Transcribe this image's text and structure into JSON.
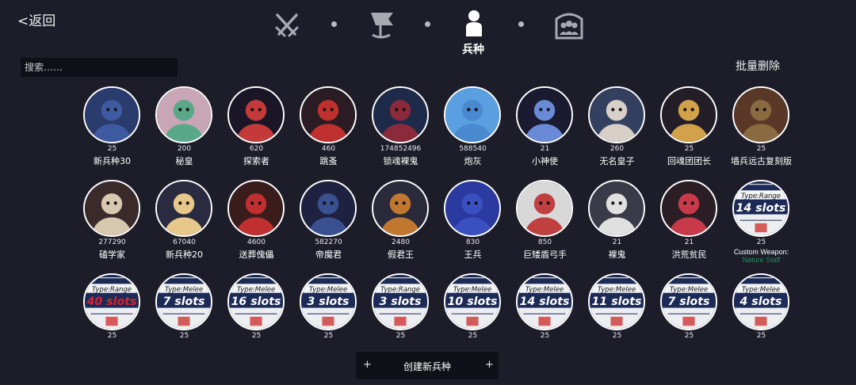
{
  "back": {
    "label": "<返回"
  },
  "nav": {
    "items": [
      {
        "icon": "crossed-swords-icon"
      },
      {
        "icon": "flag-icon"
      },
      {
        "icon": "unit-person-icon",
        "label": "兵种",
        "active": true
      },
      {
        "icon": "faction-group-icon"
      }
    ]
  },
  "search": {
    "placeholder": "搜索……",
    "value": ""
  },
  "batch_delete": {
    "label": "批量删除"
  },
  "units": [
    {
      "cost": "25",
      "name": "新兵种30",
      "icon": "hooded-blue-unit-icon"
    },
    {
      "cost": "200",
      "name": "秘皇",
      "icon": "masked-emperor-icon"
    },
    {
      "cost": "620",
      "name": "探索者",
      "icon": "explorer-teeth-icon"
    },
    {
      "cost": "460",
      "name": "跳蚤",
      "icon": "flea-red-unit-icon"
    },
    {
      "cost": "174852496",
      "name": "锁魂裸鬼",
      "icon": "soul-lock-ghost-icon"
    },
    {
      "cost": "588540",
      "name": "炮灰",
      "icon": "blue-blob-icon"
    },
    {
      "cost": "21",
      "name": "小神使",
      "icon": "little-envoy-icon"
    },
    {
      "cost": "260",
      "name": "无名皇子",
      "icon": "nameless-prince-icon"
    },
    {
      "cost": "25",
      "name": "回魂团团长",
      "icon": "soul-captain-icon"
    },
    {
      "cost": "25",
      "name": "墙兵远古复刻版",
      "icon": "wizard-hat-icon"
    },
    {
      "cost": "277290",
      "name": "磕学家",
      "icon": "antler-scholar-icon"
    },
    {
      "cost": "67040",
      "name": "新兵种20",
      "icon": "gold-robe-unit-icon"
    },
    {
      "cost": "4600",
      "name": "送葬傀儡",
      "icon": "funeral-puppet-icon"
    },
    {
      "cost": "582270",
      "name": "帝魔君",
      "icon": "demon-lord-icon"
    },
    {
      "cost": "2480",
      "name": "假君王",
      "icon": "false-king-icon"
    },
    {
      "cost": "830",
      "name": "王兵",
      "icon": "royal-soldier-icon"
    },
    {
      "cost": "850",
      "name": "巨矮盾弓手",
      "icon": "snowman-archer-icon"
    },
    {
      "cost": "21",
      "name": "裸鬼",
      "icon": "white-ghost-icon"
    },
    {
      "cost": "21",
      "name": "洪荒贫民",
      "icon": "primal-pauper-icon"
    },
    {
      "cost": "25",
      "name": "",
      "icon": "weapon-card-icon",
      "card_type": "Type:Range",
      "card_slots": "14 slots",
      "extra_line1": "Custom Weapon:",
      "extra_line2": "Nature Staff"
    },
    {
      "cost": "25",
      "card_type": "Type:Range",
      "card_slots": "40 slots",
      "slots_color": "#e0212e",
      "icon": "weapon-card-icon"
    },
    {
      "cost": "25",
      "card_type": "Type:Melee",
      "card_slots": "7 slots",
      "icon": "weapon-card-icon"
    },
    {
      "cost": "25",
      "card_type": "Type:Melee",
      "card_slots": "16 slots",
      "icon": "weapon-card-icon"
    },
    {
      "cost": "25",
      "card_type": "Type:Melee",
      "card_slots": "3 slots",
      "icon": "weapon-card-icon"
    },
    {
      "cost": "25",
      "card_type": "Type:Range",
      "card_slots": "3 slots",
      "icon": "weapon-card-icon"
    },
    {
      "cost": "25",
      "card_type": "Type:Melee",
      "card_slots": "10 slots",
      "icon": "weapon-card-icon"
    },
    {
      "cost": "25",
      "card_type": "Type:Melee",
      "card_slots": "14 slots",
      "icon": "weapon-card-icon"
    },
    {
      "cost": "25",
      "card_type": "Type:Melee",
      "card_slots": "11 slots",
      "icon": "weapon-card-icon"
    },
    {
      "cost": "25",
      "card_type": "Type:Melee",
      "card_slots": "7 slots",
      "icon": "weapon-card-icon"
    },
    {
      "cost": "25",
      "card_type": "Type:Melee",
      "card_slots": "4 slots",
      "icon": "weapon-card-icon"
    }
  ],
  "create": {
    "label": "创建新兵种",
    "plus_left": "+",
    "plus_right": "+"
  },
  "colors": {
    "background": "#1d1d29",
    "card_bg": "#1c2a56",
    "accent_red": "#e0212e",
    "nature_green": "#1f8f5a"
  }
}
